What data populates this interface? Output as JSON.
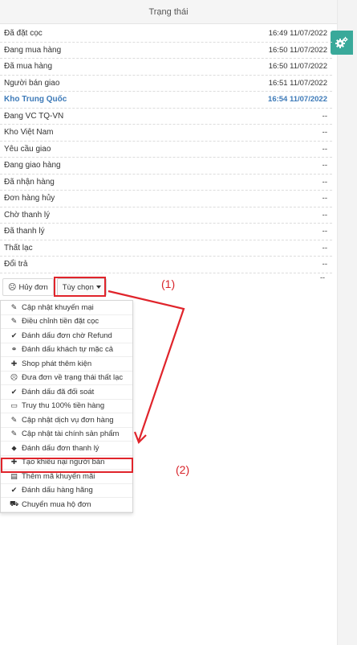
{
  "panel": {
    "title": "Trạng thái"
  },
  "right_panel": {
    "icon": "gears-icon",
    "accent_color": "#39a99a"
  },
  "status_rows": [
    {
      "label": "Đã đặt cọc",
      "time": "16:49 11/07/2022",
      "highlight": false
    },
    {
      "label": "Đang mua hàng",
      "time": "16:50 11/07/2022",
      "highlight": false
    },
    {
      "label": "Đã mua hàng",
      "time": "16:50 11/07/2022",
      "highlight": false
    },
    {
      "label": "Người bán giao",
      "time": "16:51 11/07/2022",
      "highlight": false
    },
    {
      "label": "Kho Trung Quốc",
      "time": "16:54 11/07/2022",
      "highlight": true
    },
    {
      "label": "Đang VC TQ-VN",
      "time": "--",
      "highlight": false
    },
    {
      "label": "Kho Việt Nam",
      "time": "--",
      "highlight": false
    },
    {
      "label": "Yêu cầu giao",
      "time": "--",
      "highlight": false
    },
    {
      "label": "Đang giao hàng",
      "time": "--",
      "highlight": false
    },
    {
      "label": "Đã nhận hàng",
      "time": "--",
      "highlight": false
    },
    {
      "label": "Đơn hàng hủy",
      "time": "--",
      "highlight": false
    },
    {
      "label": "Chờ thanh lý",
      "time": "--",
      "highlight": false
    },
    {
      "label": "Đã thanh lý",
      "time": "--",
      "highlight": false
    },
    {
      "label": "Thất lạc",
      "time": "--",
      "highlight": false
    },
    {
      "label": "Đổi trả",
      "time": "--",
      "highlight": false
    }
  ],
  "stray_dash": "--",
  "actions": {
    "cancel_label": "Hủy đơn",
    "options_label": "Tùy chọn"
  },
  "menu": [
    {
      "label": "Cập nhật khuyến mại",
      "icon": "pencil-icon",
      "glyph": "✎"
    },
    {
      "label": "Điều chỉnh tiền đặt cọc",
      "icon": "edit-icon",
      "glyph": "✎"
    },
    {
      "label": "Đánh dấu đơn chờ Refund",
      "icon": "check-icon",
      "glyph": "✔"
    },
    {
      "label": "Đánh dấu khách tự mặc cả",
      "icon": "handshake-icon",
      "glyph": "⚭"
    },
    {
      "label": "Shop phát thêm kiện",
      "icon": "plus-icon",
      "glyph": "✚"
    },
    {
      "label": "Đưa đơn về trạng thái thất lạc",
      "icon": "frown-icon",
      "glyph": "☹"
    },
    {
      "label": "Đánh dấu đã đối soát",
      "icon": "check-circle-icon",
      "glyph": "✔"
    },
    {
      "label": "Truy thu 100% tiền hàng",
      "icon": "money-icon",
      "glyph": "▭"
    },
    {
      "label": "Cập nhật dịch vụ đơn hàng",
      "icon": "edit-icon",
      "glyph": "✎"
    },
    {
      "label": "Cập nhật tài chính sản phẩm",
      "icon": "edit-icon",
      "glyph": "✎"
    },
    {
      "label": "Đánh dấu đơn thanh lý",
      "icon": "tag-icon",
      "glyph": "⬥"
    },
    {
      "label": "Tạo khiếu nại người bán",
      "icon": "plus-icon",
      "glyph": "✚"
    },
    {
      "label": "Thêm mã khuyến mãi",
      "icon": "calculator-icon",
      "glyph": "▤"
    },
    {
      "label": "Đánh dấu hàng hãng",
      "icon": "check-icon",
      "glyph": "✔"
    },
    {
      "label": "Chuyển mua hộ đơn",
      "icon": "cart-icon",
      "glyph": "⛟"
    }
  ],
  "annotations": {
    "label_1": "(1)",
    "label_2": "(2)",
    "color": "#e0242b"
  }
}
